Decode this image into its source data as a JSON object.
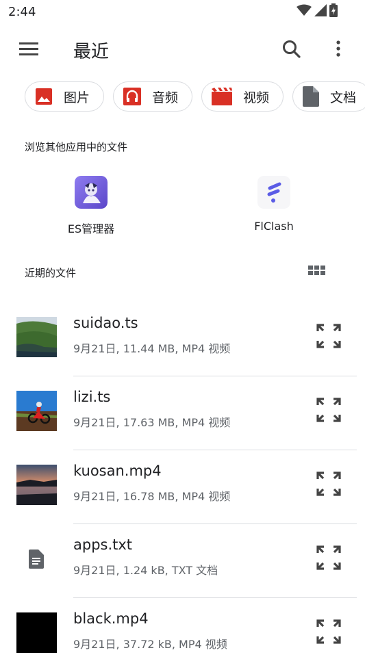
{
  "status_bar": {
    "time": "2:44"
  },
  "app_bar": {
    "title": "最近"
  },
  "chips": [
    {
      "label": "图片",
      "icon": "image-icon",
      "color": "#d93025"
    },
    {
      "label": "音频",
      "icon": "headphones-icon",
      "color": "#d93025"
    },
    {
      "label": "视频",
      "icon": "movie-icon",
      "color": "#d93025"
    },
    {
      "label": "文档",
      "icon": "document-icon",
      "color": "#5f6368"
    }
  ],
  "other_apps": {
    "heading": "浏览其他应用中的文件",
    "apps": [
      {
        "name": "ES管理器",
        "icon": "es-file-manager-icon"
      },
      {
        "name": "FlClash",
        "icon": "flclash-icon"
      }
    ]
  },
  "recent": {
    "heading": "近期的文件",
    "files": [
      {
        "name": "suidao.ts",
        "meta": "9月21日, 11.44 MB, MP4 视频",
        "thumbnail": "landscape-green-thumbnail"
      },
      {
        "name": "lizi.ts",
        "meta": "9月21日, 17.63 MB, MP4 视频",
        "thumbnail": "motorcycle-thumbnail"
      },
      {
        "name": "kuosan.mp4",
        "meta": "9月21日, 16.78 MB, MP4 视频",
        "thumbnail": "sunset-lake-thumbnail"
      },
      {
        "name": "apps.txt",
        "meta": "9月21日, 1.24 kB, TXT 文档",
        "thumbnail": "text-file-icon"
      },
      {
        "name": "black.mp4",
        "meta": "9月21日, 37.72 kB, MP4 视频",
        "thumbnail": "black-thumbnail"
      }
    ]
  }
}
